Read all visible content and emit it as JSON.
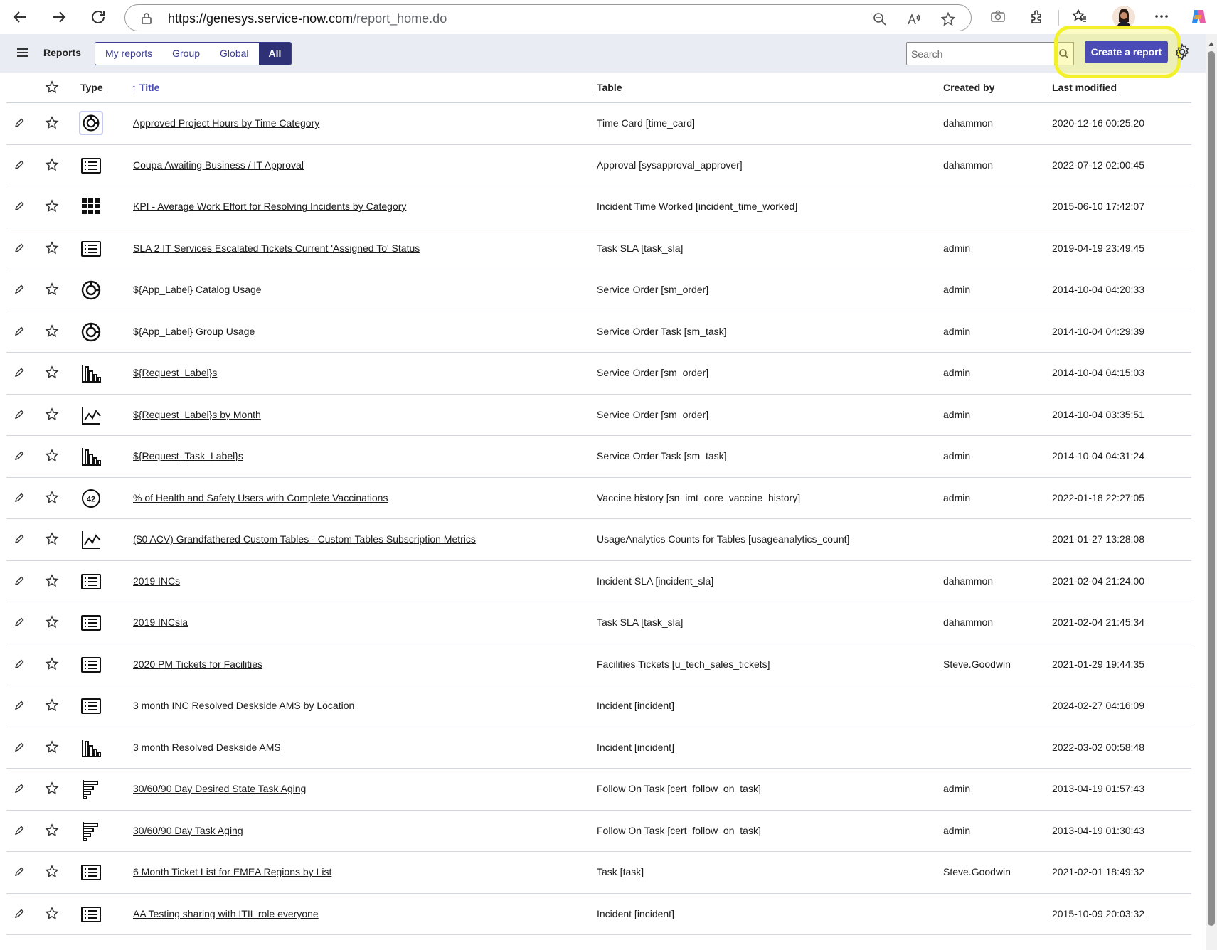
{
  "browser": {
    "url_host": "https://genesys.service-now.com",
    "url_path": "/report_home.do"
  },
  "header": {
    "title": "Reports",
    "tabs": [
      {
        "label": "My reports",
        "active": false
      },
      {
        "label": "Group",
        "active": false
      },
      {
        "label": "Global",
        "active": false
      },
      {
        "label": "All",
        "active": true
      }
    ],
    "search_placeholder": "Search",
    "create_label": "Create a report"
  },
  "colors": {
    "primary": "#4a4bb5",
    "tab_active": "#2f3176",
    "highlight": "#f2f12b",
    "header_bg": "#e9ecf2"
  },
  "columns": {
    "type": "Type",
    "title": "Title",
    "sort_indicator": "↑",
    "table": "Table",
    "created_by": "Created by",
    "last_modified": "Last modified"
  },
  "rows": [
    {
      "type_icon": "donut-icon",
      "title": "Approved Project Hours by Time Category",
      "table": "Time Card [time_card]",
      "created_by": "dahammon",
      "modified": "2020-12-16 00:25:20"
    },
    {
      "type_icon": "list-icon",
      "title": "Coupa Awaiting Business / IT Approval",
      "table": "Approval [sysapproval_approver]",
      "created_by": "dahammon",
      "modified": "2022-07-12 02:00:45"
    },
    {
      "type_icon": "heatmap-icon",
      "title": "KPI - Average Work Effort for Resolving Incidents by Category",
      "table": "Incident Time Worked [incident_time_worked]",
      "created_by": "",
      "modified": "2015-06-10 17:42:07"
    },
    {
      "type_icon": "list-icon",
      "title": "SLA 2 IT Services Escalated Tickets Current 'Assigned To' Status",
      "table": "Task SLA [task_sla]",
      "created_by": "admin",
      "modified": "2019-04-19 23:49:45"
    },
    {
      "type_icon": "donut-icon",
      "title": "${App_Label} Catalog Usage",
      "table": "Service Order [sm_order]",
      "created_by": "admin",
      "modified": "2014-10-04 04:20:33"
    },
    {
      "type_icon": "donut-icon",
      "title": "${App_Label} Group Usage",
      "table": "Service Order Task [sm_task]",
      "created_by": "admin",
      "modified": "2014-10-04 04:29:39"
    },
    {
      "type_icon": "bar-chart-icon",
      "title": "${Request_Label}s",
      "table": "Service Order [sm_order]",
      "created_by": "admin",
      "modified": "2014-10-04 04:15:03"
    },
    {
      "type_icon": "line-chart-icon",
      "title": "${Request_Label}s by Month",
      "table": "Service Order [sm_order]",
      "created_by": "admin",
      "modified": "2014-10-04 03:35:51"
    },
    {
      "type_icon": "bar-chart-icon",
      "title": "${Request_Task_Label}s",
      "table": "Service Order Task [sm_task]",
      "created_by": "admin",
      "modified": "2014-10-04 04:31:24"
    },
    {
      "type_icon": "single-score-icon",
      "score_label": "42",
      "title": "% of Health and Safety Users with Complete Vaccinations",
      "table": "Vaccine history [sn_imt_core_vaccine_history]",
      "created_by": "admin",
      "modified": "2022-01-18 22:27:05"
    },
    {
      "type_icon": "line-chart-icon",
      "title": "($0 ACV) Grandfathered Custom Tables - Custom Tables Subscription Metrics",
      "table": "UsageAnalytics Counts for Tables [usageanalytics_count]",
      "created_by": "",
      "modified": "2021-01-27 13:28:08"
    },
    {
      "type_icon": "list-icon",
      "title": "2019 INCs",
      "table": "Incident SLA [incident_sla]",
      "created_by": "dahammon",
      "modified": "2021-02-04 21:24:00"
    },
    {
      "type_icon": "list-icon",
      "title": "2019 INCsla",
      "table": "Task SLA [task_sla]",
      "created_by": "dahammon",
      "modified": "2021-02-04 21:45:34"
    },
    {
      "type_icon": "list-icon",
      "title": "2020 PM Tickets for Facilities",
      "table": "Facilities Tickets [u_tech_sales_tickets]",
      "created_by": "Steve.Goodwin",
      "modified": "2021-01-29 19:44:35"
    },
    {
      "type_icon": "list-icon",
      "title": "3 month INC Resolved Deskside AMS by Location",
      "table": "Incident [incident]",
      "created_by": "",
      "modified": "2024-02-27 04:16:09"
    },
    {
      "type_icon": "bar-chart-icon",
      "title": "3 month Resolved Deskside AMS",
      "table": "Incident [incident]",
      "created_by": "",
      "modified": "2022-03-02 00:58:48"
    },
    {
      "type_icon": "horizontal-bar-icon",
      "title": "30/60/90 Day Desired State Task Aging",
      "table": "Follow On Task [cert_follow_on_task]",
      "created_by": "admin",
      "modified": "2013-04-19 01:57:43"
    },
    {
      "type_icon": "horizontal-bar-icon",
      "title": "30/60/90 Day Task Aging",
      "table": "Follow On Task [cert_follow_on_task]",
      "created_by": "admin",
      "modified": "2013-04-19 01:30:43"
    },
    {
      "type_icon": "list-icon",
      "title": "6 Month Ticket List for EMEA Regions by List",
      "table": "Task [task]",
      "created_by": "Steve.Goodwin",
      "modified": "2021-02-01 18:49:32"
    },
    {
      "type_icon": "list-icon",
      "title": "AA Testing sharing with ITIL role everyone",
      "table": "Incident [incident]",
      "created_by": "",
      "modified": "2015-10-09 20:03:32"
    }
  ]
}
